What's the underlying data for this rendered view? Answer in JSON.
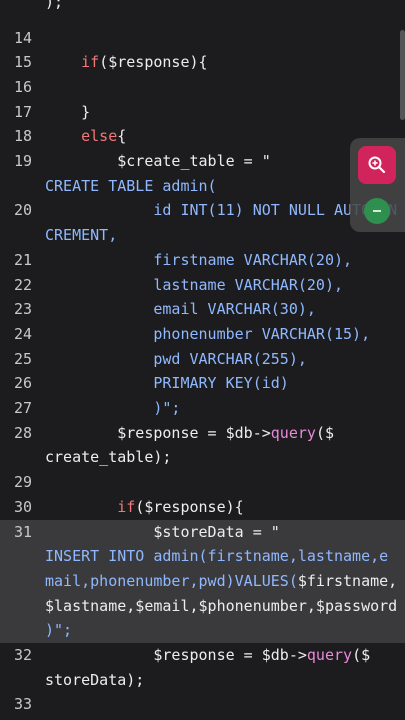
{
  "editor": {
    "partial_top": ");",
    "lines": [
      {
        "num": "14",
        "code": [
          {
            "t": ""
          }
        ]
      },
      {
        "num": "15",
        "code": [
          {
            "t": "    ",
            "c": "pl"
          },
          {
            "t": "if",
            "c": "kw"
          },
          {
            "t": "($response){",
            "c": "pl"
          }
        ]
      },
      {
        "num": "16",
        "code": [
          {
            "t": ""
          }
        ]
      },
      {
        "num": "17",
        "code": [
          {
            "t": "    }",
            "c": "pl"
          }
        ]
      },
      {
        "num": "18",
        "code": [
          {
            "t": "    ",
            "c": "pl"
          },
          {
            "t": "else",
            "c": "kw"
          },
          {
            "t": "{",
            "c": "pl"
          }
        ]
      },
      {
        "num": "19",
        "code": [
          {
            "t": "        $create_table = \"",
            "c": "pl"
          }
        ]
      },
      {
        "num": "",
        "code": [
          {
            "t": "CREATE TABLE admin(",
            "c": "str"
          }
        ]
      },
      {
        "num": "20",
        "code": [
          {
            "t": "            id INT(11) NOT NULL AUTO_IN",
            "c": "str"
          }
        ]
      },
      {
        "num": "",
        "code": [
          {
            "t": "CREMENT,",
            "c": "str"
          }
        ]
      },
      {
        "num": "21",
        "code": [
          {
            "t": "            firstname VARCHAR(20),",
            "c": "str"
          }
        ]
      },
      {
        "num": "22",
        "code": [
          {
            "t": "            lastname VARCHAR(20),",
            "c": "str"
          }
        ]
      },
      {
        "num": "23",
        "code": [
          {
            "t": "            email VARCHAR(30),",
            "c": "str"
          }
        ]
      },
      {
        "num": "24",
        "code": [
          {
            "t": "            phonenumber VARCHAR(15),",
            "c": "str"
          }
        ]
      },
      {
        "num": "25",
        "code": [
          {
            "t": "            pwd VARCHAR(255),",
            "c": "str"
          }
        ]
      },
      {
        "num": "26",
        "code": [
          {
            "t": "            PRIMARY KEY(id)",
            "c": "str"
          }
        ]
      },
      {
        "num": "27",
        "code": [
          {
            "t": "            )\";",
            "c": "str"
          }
        ]
      },
      {
        "num": "28",
        "code": [
          {
            "t": "        $response = $db->",
            "c": "pl"
          },
          {
            "t": "query",
            "c": "fn"
          },
          {
            "t": "($",
            "c": "pl"
          }
        ]
      },
      {
        "num": "",
        "code": [
          {
            "t": "create_table);",
            "c": "pl"
          }
        ]
      },
      {
        "num": "29",
        "code": [
          {
            "t": ""
          }
        ]
      },
      {
        "num": "30",
        "code": [
          {
            "t": "        ",
            "c": "pl"
          },
          {
            "t": "if",
            "c": "kw"
          },
          {
            "t": "($response){",
            "c": "pl"
          }
        ]
      },
      {
        "num": "31",
        "hl": true,
        "code": [
          {
            "t": "            $storeData = \"",
            "c": "pl"
          }
        ]
      },
      {
        "num": "",
        "hl": true,
        "code": [
          {
            "t": "INSERT INTO admin(firstname,lastname,e",
            "c": "str"
          }
        ]
      },
      {
        "num": "",
        "hl": true,
        "code": [
          {
            "t": "mail,phonenumber,pwd)VALUES(",
            "c": "str"
          },
          {
            "t": "$firstname,",
            "c": "pl"
          }
        ]
      },
      {
        "num": "",
        "hl": true,
        "code": [
          {
            "t": "$lastname,$email,$phonenumber,$password",
            "c": "pl"
          }
        ]
      },
      {
        "num": "",
        "hl": true,
        "code": [
          {
            "t": ")\";",
            "c": "str"
          }
        ]
      },
      {
        "num": "32",
        "code": [
          {
            "t": "            $response = $db->",
            "c": "pl"
          },
          {
            "t": "query",
            "c": "fn"
          },
          {
            "t": "($",
            "c": "pl"
          }
        ]
      },
      {
        "num": "",
        "code": [
          {
            "t": "storeData);",
            "c": "pl"
          }
        ]
      },
      {
        "num": "33",
        "code": [
          {
            "t": ""
          }
        ]
      }
    ]
  },
  "overlay": {
    "zoom_icon": "zoom-in-icon",
    "secondary_icon": "circle-action-icon"
  },
  "colors": {
    "background": "#1c1c1e",
    "keyword": "#f07878",
    "function": "#e88ad9",
    "string": "#8fb8ff",
    "highlight": "#3a3a3c",
    "zoom_button": "#d1245c"
  }
}
